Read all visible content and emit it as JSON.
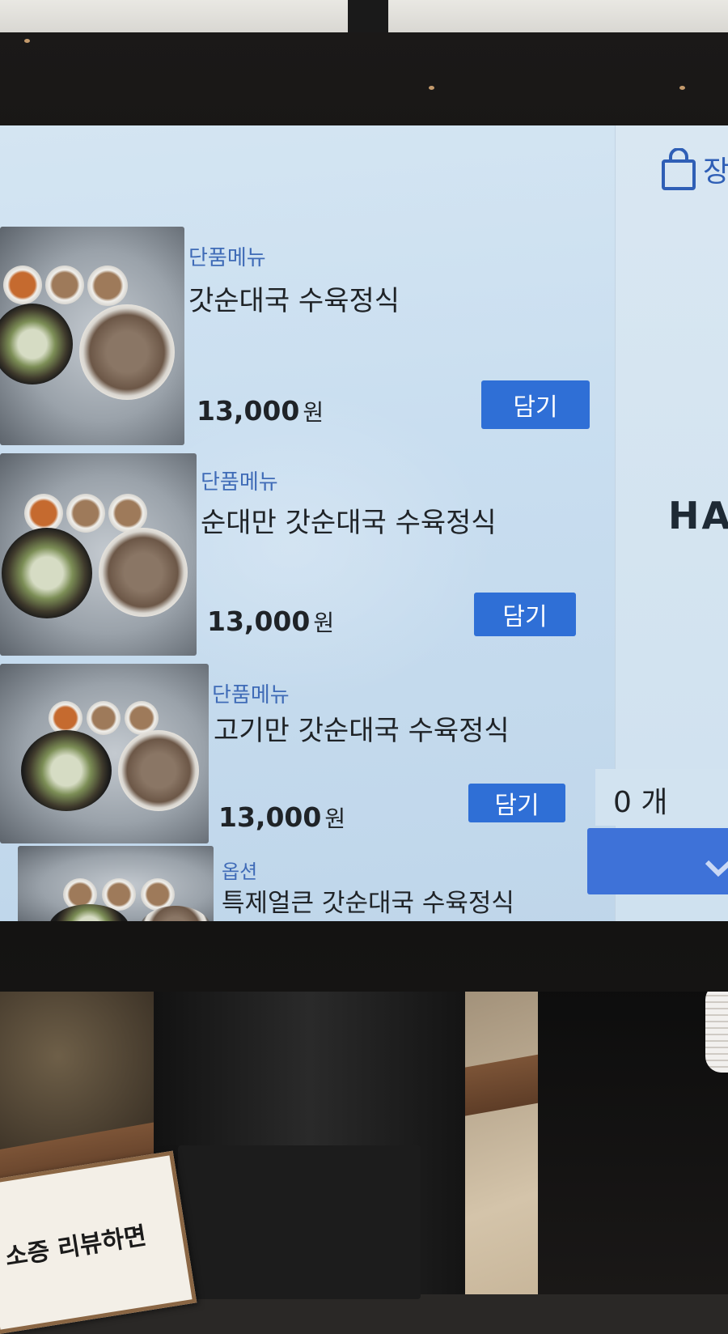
{
  "menu": {
    "items": [
      {
        "category": "단품메뉴",
        "name": "갓순대국 수육정식",
        "price": "13,000",
        "unit": "원",
        "add_label": "담기"
      },
      {
        "category": "단품메뉴",
        "name": "순대만 갓순대국 수육정식",
        "price": "13,000",
        "unit": "원",
        "add_label": "담기"
      },
      {
        "category": "단품메뉴",
        "name": "고기만 갓순대국 수육정식",
        "price": "13,000",
        "unit": "원",
        "add_label": "담기"
      },
      {
        "category": "옵션",
        "name": "특제얼큰 갓순대국 수육정식"
      }
    ]
  },
  "cart": {
    "label": "장",
    "count_text": "0 개",
    "logo_text": "HA"
  },
  "sign": {
    "text": "소증 리뷰하면"
  },
  "colors": {
    "accent": "#2f6fd6",
    "category": "#3f6bb7",
    "screen_bg": "#c9def0"
  }
}
